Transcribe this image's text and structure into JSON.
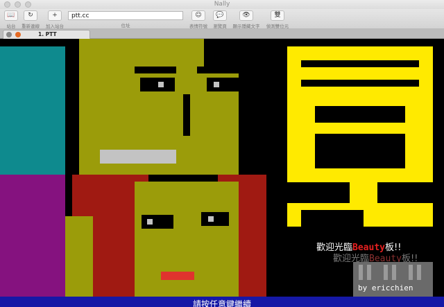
{
  "window": {
    "title": "Nally"
  },
  "toolbar": {
    "sites_label": "站台",
    "reconnect_label": "重新連線",
    "add_site_label": "加入站台",
    "address_value": "ptt.cc",
    "address_label": "位址",
    "emoticon_label": "表情符號",
    "browse_label": "瀏覽頁",
    "show_hidden_label": "顯示隱藏文字",
    "detect_label": "偵測雙位元",
    "detect_glyph": "雙"
  },
  "tabs": [
    {
      "label": "1. PTT"
    }
  ],
  "terminal": {
    "welcome_prefix": "歡迎光臨",
    "welcome_board": "Beauty",
    "welcome_suffix": "板!!",
    "signature": "by ericchien",
    "status_text": "請按任意鍵繼續"
  },
  "colors": {
    "teal": "#0e8a8e",
    "purple": "#85127f",
    "olive": "#9b9c0a",
    "yellow": "#ffea00",
    "status_blue": "#1518a6",
    "red": "#e62020"
  }
}
